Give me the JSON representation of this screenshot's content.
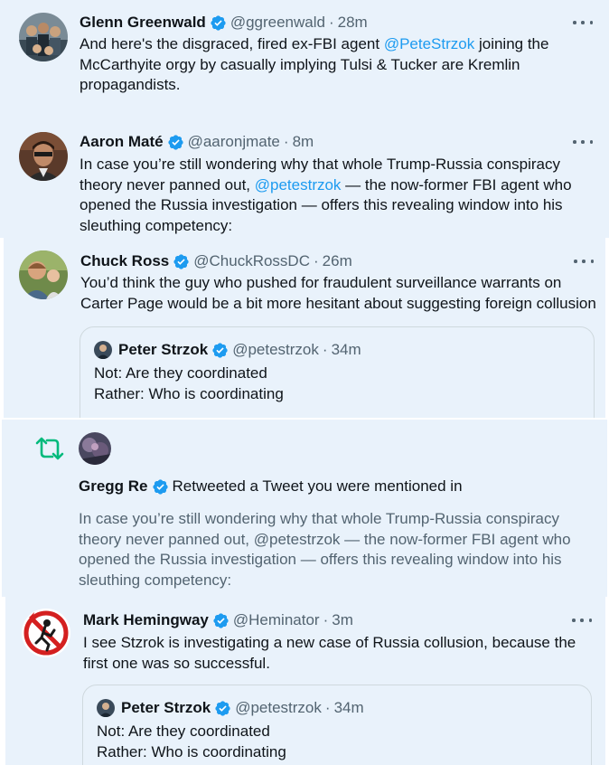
{
  "tweets": [
    {
      "name": "Glenn Greenwald",
      "handle": "@ggreenwald",
      "time": "28m",
      "text_pre": "And here's the disgraced, fired ex-FBI agent ",
      "mention": "@PeteStrzok",
      "text_post": " joining the McCarthyite orgy by casually implying Tulsi & Tucker are Kremlin propagandists."
    },
    {
      "name": "Aaron Maté",
      "handle": "@aaronjmate",
      "time": "8m",
      "text_pre": "In case you’re still wondering why that whole Trump-Russia conspiracy theory never panned out, ",
      "mention": "@petestrzok",
      "text_post": " — the now-former FBI agent who opened the Russia investigation — offers this revealing window into his sleuthing competency:"
    },
    {
      "name": "Chuck Ross",
      "handle": "@ChuckRossDC",
      "time": "26m",
      "text": "You’d think the guy who pushed for fraudulent surveillance warrants on Carter Page would be a bit more hesitant about suggesting foreign collusion",
      "quote": {
        "name": "Peter Strzok",
        "handle": "@petestrzok",
        "time": "34m",
        "line1": "Not: Are they coordinated",
        "line2": "Rather: Who is coordinating"
      }
    },
    {
      "name": "Mark Hemingway",
      "handle": "@Heminator",
      "time": "3m",
      "text": "I see Stzrok is investigating a new case of Russia collusion, because the first one was so successful.",
      "quote": {
        "name": "Peter Strzok",
        "handle": "@petestrzok",
        "time": "34m",
        "line1": "Not: Are they coordinated",
        "line2": "Rather: Who is coordinating"
      }
    }
  ],
  "retweet": {
    "name": "Gregg Re",
    "action": "Retweeted a Tweet you were mentioned in",
    "text": "In case you’re still wondering why that whole Trump-Russia conspiracy theory never panned out, @petestrzok — the now-former FBI agent who opened the Russia investigation — offers this revealing window into his sleuthing competency:"
  },
  "separator": "·",
  "colors": {
    "panel": "#e9f2fb",
    "accent": "#1d9bf0",
    "retweet_green": "#00ba7c"
  }
}
